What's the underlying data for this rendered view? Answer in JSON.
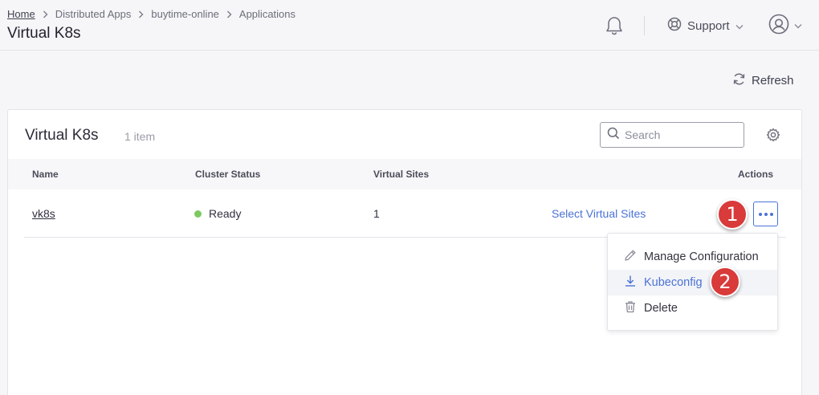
{
  "breadcrumb": {
    "items": [
      "Home",
      "Distributed Apps",
      "buytime-online",
      "Applications"
    ]
  },
  "header": {
    "title": "Virtual K8s",
    "support_label": "Support",
    "icons": [
      "bell-icon",
      "support-icon",
      "user-icon",
      "chevron-down-icon"
    ]
  },
  "toolbar": {
    "refresh_label": "Refresh"
  },
  "card": {
    "title": "Virtual K8s",
    "item_count": "1 item",
    "search_placeholder": "Search"
  },
  "table": {
    "columns": [
      "Name",
      "Cluster Status",
      "Virtual Sites",
      "Actions"
    ],
    "rows": [
      {
        "name": "vk8s",
        "status": "Ready",
        "status_color": "#7cc960",
        "virtual_sites": "1",
        "link": "Select Virtual Sites"
      }
    ]
  },
  "actions_menu": {
    "items": [
      {
        "label": "Manage Configuration",
        "icon": "pencil-icon"
      },
      {
        "label": "Kubeconfig",
        "icon": "download-icon",
        "highlighted": true
      },
      {
        "label": "Delete",
        "icon": "trash-icon"
      }
    ]
  },
  "callouts": [
    "1",
    "2"
  ],
  "colors": {
    "accent": "#4a72d6",
    "badge": "#d93a3a",
    "ready": "#7cc960"
  }
}
